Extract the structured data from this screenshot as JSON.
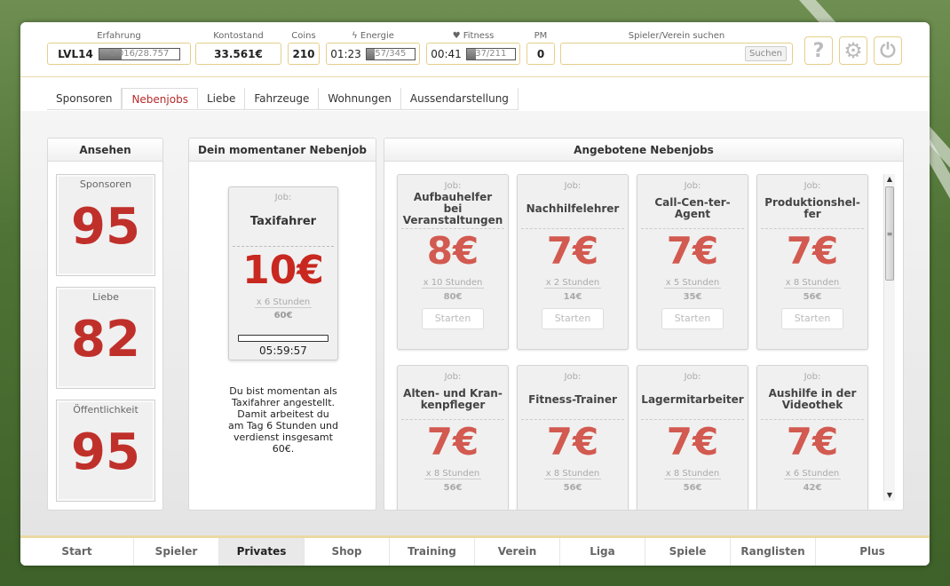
{
  "topbar": {
    "level": "LVL14",
    "experience": {
      "label": "Erfahrung",
      "value": "8.016/28.757",
      "progress": 0.28
    },
    "balance": {
      "label": "Kontostand",
      "value": "33.561€"
    },
    "coins": {
      "label": "Coins",
      "value": "210"
    },
    "energy": {
      "label": "Energie",
      "icon": "lightning-icon",
      "timer": "01:23",
      "value": "57/345",
      "progress": 0.17
    },
    "fitness": {
      "label": "Fitness",
      "icon": "heart-icon",
      "timer": "00:41",
      "value": "37/211",
      "progress": 0.18
    },
    "pm": {
      "label": "PM",
      "value": "0"
    },
    "search": {
      "label": "Spieler/Verein suchen",
      "placeholder": "",
      "button": "Suchen"
    },
    "icons": {
      "help": "?",
      "settings": "⚙",
      "power": "⏻"
    }
  },
  "subnav": {
    "tabs": [
      "Sponsoren",
      "Nebenjobs",
      "Liebe",
      "Fahrzeuge",
      "Wohnungen",
      "Aussendarstellung"
    ],
    "active": "Nebenjobs"
  },
  "ansehen": {
    "title": "Ansehen",
    "items": [
      {
        "label": "Sponsoren",
        "value": "95"
      },
      {
        "label": "Liebe",
        "value": "82"
      },
      {
        "label": "Öffentlichkeit",
        "value": "95"
      }
    ]
  },
  "current_job": {
    "title": "Dein momentaner Nebenjob",
    "job_label": "Job:",
    "name": "Taxifahrer",
    "price": "10€",
    "hours": "x 6 Stunden",
    "total": "60€",
    "progress": 0,
    "timer": "05:59:57",
    "description": "Du bist momentan als Taxifahrer angestellt. Damit arbeitest du am Tag 6 Stunden und verdienst insgesamt 60€."
  },
  "offered_jobs": {
    "title": "Angebotene Nebenjobs",
    "job_label": "Job:",
    "start_label": "Starten",
    "jobs": [
      {
        "name": "Aufbauhelfer bei Veranstaltungen",
        "price": "8€",
        "hours": "x 10 Stunden",
        "total": "80€"
      },
      {
        "name": "Nachhilfelehrer",
        "price": "7€",
        "hours": "x 2 Stunden",
        "total": "14€"
      },
      {
        "name": "Call-Cen-ter-Agent",
        "price": "7€",
        "hours": "x 5 Stunden",
        "total": "35€"
      },
      {
        "name": "Produktionshel-fer",
        "price": "7€",
        "hours": "x 8 Stunden",
        "total": "56€"
      },
      {
        "name": "Alten- und Kran-kenpfleger",
        "price": "7€",
        "hours": "x 8 Stunden",
        "total": "56€"
      },
      {
        "name": "Fitness-Trainer",
        "price": "7€",
        "hours": "x 8 Stunden",
        "total": "56€"
      },
      {
        "name": "Lagermitarbeiter",
        "price": "7€",
        "hours": "x 8 Stunden",
        "total": "56€"
      },
      {
        "name": "Aushilfe in der Videothek",
        "price": "7€",
        "hours": "x 6 Stunden",
        "total": "42€"
      }
    ]
  },
  "bottomnav": {
    "items": [
      "Start",
      "Spieler",
      "Privates",
      "Shop",
      "Training",
      "Verein",
      "Liga",
      "Spiele",
      "Ranglisten",
      "Plus"
    ],
    "active": "Privates"
  }
}
